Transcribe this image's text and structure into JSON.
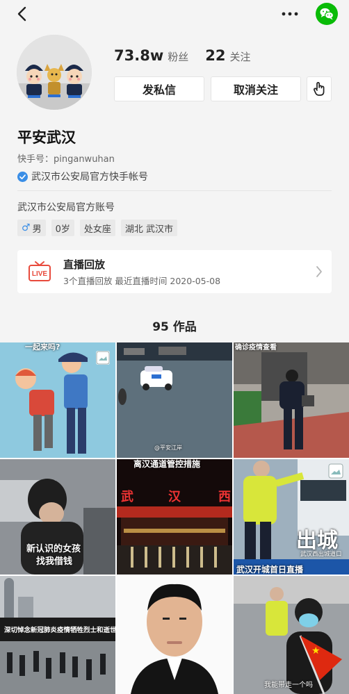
{
  "header": {
    "back_icon": "chevron-left-icon",
    "more_icon": "more-dots-icon",
    "share_icon": "wechat-icon",
    "share_color": "#09bb07"
  },
  "profile": {
    "fans_count": "73.8w",
    "fans_label": "粉丝",
    "following_count": "22",
    "following_label": "关注",
    "message_label": "发私信",
    "unfollow_label": "取消关注",
    "more_icon": "hand-pointer-icon",
    "name": "平安武汉",
    "account_id": "快手号：pinganwuhan",
    "verified_text": "武汉市公安局官方快手帐号",
    "verified_color": "#3a8ee6",
    "bio": "武汉市公安局官方账号",
    "tags": {
      "gender": "男",
      "age": "0岁",
      "zodiac": "处女座",
      "location": "湖北 武汉市"
    }
  },
  "live": {
    "icon": "live-icon",
    "icon_text": "LIVE",
    "title": "直播回放",
    "subtitle": "3个直播回放 最近直播时间 2020-05-08"
  },
  "works": {
    "count_label": "95 作品"
  },
  "thumbnails": {
    "t1_caption": "一起来吗?",
    "t2_caption": "@平安江岸",
    "t3_caption": "确诊疫情查看",
    "t4_caption_line1": "新认识的女孩",
    "t4_caption_line2": "找我借钱",
    "t5_caption_top": "离汉通道管控措施",
    "t5_caption_char1": "武",
    "t5_caption_char2": "汉",
    "t5_caption_char3": "西",
    "t6_caption_big": "出城",
    "t6_caption_small": "武汉西出城道口",
    "t6_caption_bottom": "武汉开城首日直播",
    "t7_caption": "深切悼念新冠肺炎疫情牺牲烈士和逝世同胞",
    "t9_caption": "我能带走一个吗",
    "gallery_icon": "gallery-icon"
  }
}
